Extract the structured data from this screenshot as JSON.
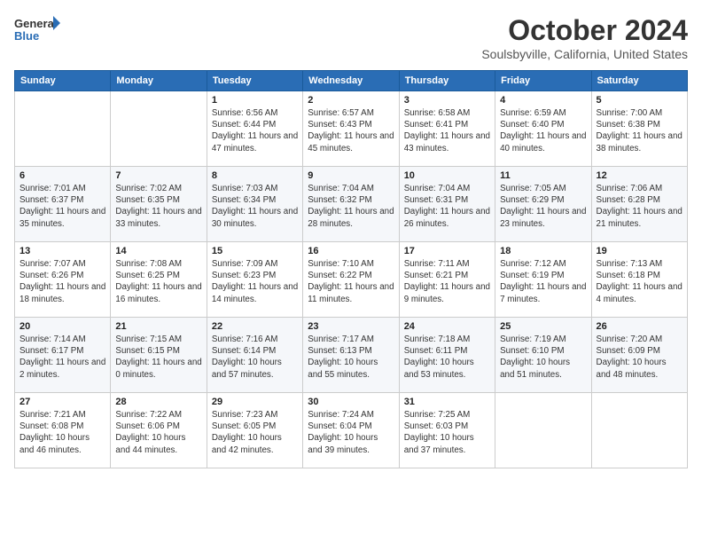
{
  "header": {
    "logo_general": "General",
    "logo_blue": "Blue",
    "month": "October 2024",
    "location": "Soulsbyville, California, United States"
  },
  "weekdays": [
    "Sunday",
    "Monday",
    "Tuesday",
    "Wednesday",
    "Thursday",
    "Friday",
    "Saturday"
  ],
  "weeks": [
    [
      {
        "day": "",
        "info": ""
      },
      {
        "day": "",
        "info": ""
      },
      {
        "day": "1",
        "info": "Sunrise: 6:56 AM\nSunset: 6:44 PM\nDaylight: 11 hours and 47 minutes."
      },
      {
        "day": "2",
        "info": "Sunrise: 6:57 AM\nSunset: 6:43 PM\nDaylight: 11 hours and 45 minutes."
      },
      {
        "day": "3",
        "info": "Sunrise: 6:58 AM\nSunset: 6:41 PM\nDaylight: 11 hours and 43 minutes."
      },
      {
        "day": "4",
        "info": "Sunrise: 6:59 AM\nSunset: 6:40 PM\nDaylight: 11 hours and 40 minutes."
      },
      {
        "day": "5",
        "info": "Sunrise: 7:00 AM\nSunset: 6:38 PM\nDaylight: 11 hours and 38 minutes."
      }
    ],
    [
      {
        "day": "6",
        "info": "Sunrise: 7:01 AM\nSunset: 6:37 PM\nDaylight: 11 hours and 35 minutes."
      },
      {
        "day": "7",
        "info": "Sunrise: 7:02 AM\nSunset: 6:35 PM\nDaylight: 11 hours and 33 minutes."
      },
      {
        "day": "8",
        "info": "Sunrise: 7:03 AM\nSunset: 6:34 PM\nDaylight: 11 hours and 30 minutes."
      },
      {
        "day": "9",
        "info": "Sunrise: 7:04 AM\nSunset: 6:32 PM\nDaylight: 11 hours and 28 minutes."
      },
      {
        "day": "10",
        "info": "Sunrise: 7:04 AM\nSunset: 6:31 PM\nDaylight: 11 hours and 26 minutes."
      },
      {
        "day": "11",
        "info": "Sunrise: 7:05 AM\nSunset: 6:29 PM\nDaylight: 11 hours and 23 minutes."
      },
      {
        "day": "12",
        "info": "Sunrise: 7:06 AM\nSunset: 6:28 PM\nDaylight: 11 hours and 21 minutes."
      }
    ],
    [
      {
        "day": "13",
        "info": "Sunrise: 7:07 AM\nSunset: 6:26 PM\nDaylight: 11 hours and 18 minutes."
      },
      {
        "day": "14",
        "info": "Sunrise: 7:08 AM\nSunset: 6:25 PM\nDaylight: 11 hours and 16 minutes."
      },
      {
        "day": "15",
        "info": "Sunrise: 7:09 AM\nSunset: 6:23 PM\nDaylight: 11 hours and 14 minutes."
      },
      {
        "day": "16",
        "info": "Sunrise: 7:10 AM\nSunset: 6:22 PM\nDaylight: 11 hours and 11 minutes."
      },
      {
        "day": "17",
        "info": "Sunrise: 7:11 AM\nSunset: 6:21 PM\nDaylight: 11 hours and 9 minutes."
      },
      {
        "day": "18",
        "info": "Sunrise: 7:12 AM\nSunset: 6:19 PM\nDaylight: 11 hours and 7 minutes."
      },
      {
        "day": "19",
        "info": "Sunrise: 7:13 AM\nSunset: 6:18 PM\nDaylight: 11 hours and 4 minutes."
      }
    ],
    [
      {
        "day": "20",
        "info": "Sunrise: 7:14 AM\nSunset: 6:17 PM\nDaylight: 11 hours and 2 minutes."
      },
      {
        "day": "21",
        "info": "Sunrise: 7:15 AM\nSunset: 6:15 PM\nDaylight: 11 hours and 0 minutes."
      },
      {
        "day": "22",
        "info": "Sunrise: 7:16 AM\nSunset: 6:14 PM\nDaylight: 10 hours and 57 minutes."
      },
      {
        "day": "23",
        "info": "Sunrise: 7:17 AM\nSunset: 6:13 PM\nDaylight: 10 hours and 55 minutes."
      },
      {
        "day": "24",
        "info": "Sunrise: 7:18 AM\nSunset: 6:11 PM\nDaylight: 10 hours and 53 minutes."
      },
      {
        "day": "25",
        "info": "Sunrise: 7:19 AM\nSunset: 6:10 PM\nDaylight: 10 hours and 51 minutes."
      },
      {
        "day": "26",
        "info": "Sunrise: 7:20 AM\nSunset: 6:09 PM\nDaylight: 10 hours and 48 minutes."
      }
    ],
    [
      {
        "day": "27",
        "info": "Sunrise: 7:21 AM\nSunset: 6:08 PM\nDaylight: 10 hours and 46 minutes."
      },
      {
        "day": "28",
        "info": "Sunrise: 7:22 AM\nSunset: 6:06 PM\nDaylight: 10 hours and 44 minutes."
      },
      {
        "day": "29",
        "info": "Sunrise: 7:23 AM\nSunset: 6:05 PM\nDaylight: 10 hours and 42 minutes."
      },
      {
        "day": "30",
        "info": "Sunrise: 7:24 AM\nSunset: 6:04 PM\nDaylight: 10 hours and 39 minutes."
      },
      {
        "day": "31",
        "info": "Sunrise: 7:25 AM\nSunset: 6:03 PM\nDaylight: 10 hours and 37 minutes."
      },
      {
        "day": "",
        "info": ""
      },
      {
        "day": "",
        "info": ""
      }
    ]
  ]
}
